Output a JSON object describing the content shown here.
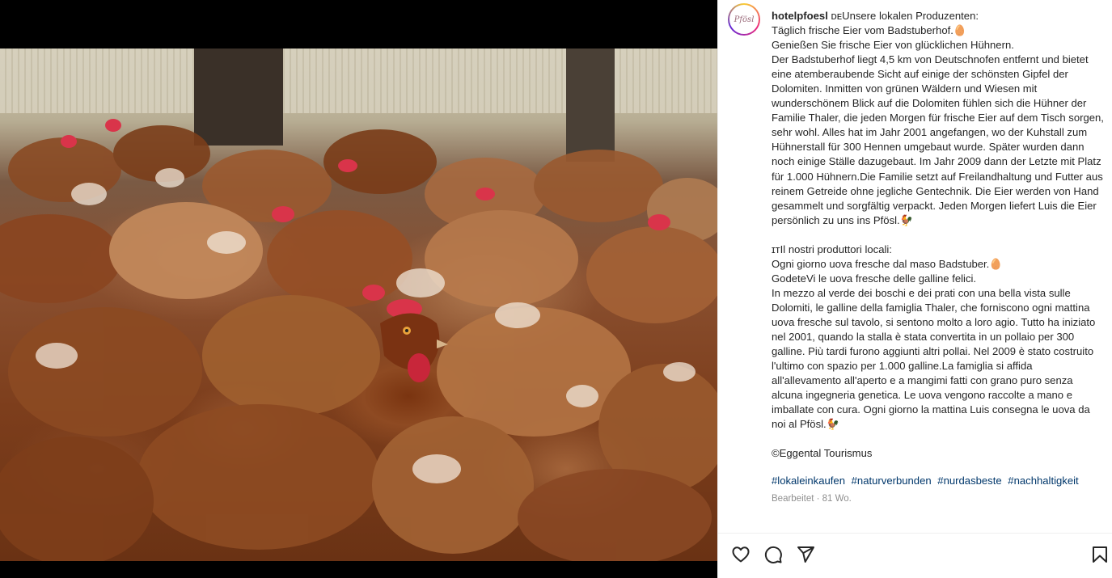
{
  "post": {
    "username": "hotelpfoesl",
    "avatar_logo_text": "Pfösl",
    "caption_de": "ᴅᴇUnsere lokalen Produzenten:\nTäglich frische Eier vom Badstuberhof.🥚\nGenießen Sie frische Eier von glücklichen Hühnern.\nDer Badstuberhof liegt 4,5 km von Deutschnofen entfernt und bietet eine atemberaubende Sicht auf einige der schönsten Gipfel der Dolomiten. Inmitten von grünen Wäldern und Wiesen mit wunderschönem Blick auf die Dolomiten fühlen sich die Hühner der Familie Thaler, die jeden Morgen für frische Eier auf dem Tisch sorgen, sehr wohl. Alles hat im Jahr 2001 angefangen, wo der Kuhstall zum Hühnerstall für 300 Hennen umgebaut wurde. Später wurden dann noch einige Ställe dazugebaut. Im Jahr 2009 dann der Letzte mit Platz für 1.000 Hühnern.Die Familie setzt auf Freilandhaltung und Futter aus reinem Getreide ohne jegliche Gentechnik. Die Eier werden von Hand gesammelt und sorgfältig verpackt. Jeden Morgen liefert Luis die Eier persönlich zu uns ins Pfösl.🐓\n\nɪᴛIl nostri produttori locali:\nOgni giorno uova fresche dal maso Badstuber.🥚\nGodeteVi le uova fresche delle galline felici.\nIn mezzo al verde dei boschi e dei prati con una bella vista sulle Dolomiti, le galline della famiglia Thaler, che forniscono ogni mattina uova fresche sul tavolo, si sentono molto a loro agio. Tutto ha iniziato nel 2001, quando la stalla è stata convertita in un pollaio per 300 galline. Più tardi furono aggiunti altri pollai. Nel 2009 è stato costruito l'ultimo con spazio per 1.000 galline.La famiglia si affida all'allevamento all'aperto e a mangimi fatti con grano puro senza alcuna ingegneria genetica. Le uova vengono raccolte a mano e imballate con cura. Ogni giorno la mattina Luis consegna le uova da noi al Pfösl.🐓\n\n©Eggental Tourismus",
    "hashtags": [
      "#lokaleinkaufen",
      "#naturverbunden",
      "#nurdasbeste",
      "#nachhaltigkeit"
    ],
    "meta": "Bearbeitet · 81 Wo."
  },
  "actions": {
    "like": "heart-icon",
    "comment": "comment-icon",
    "share": "share-icon",
    "save": "bookmark-icon"
  },
  "colors": {
    "text": "#262626",
    "hashtag": "#00376b",
    "meta": "#8e8e8e"
  }
}
